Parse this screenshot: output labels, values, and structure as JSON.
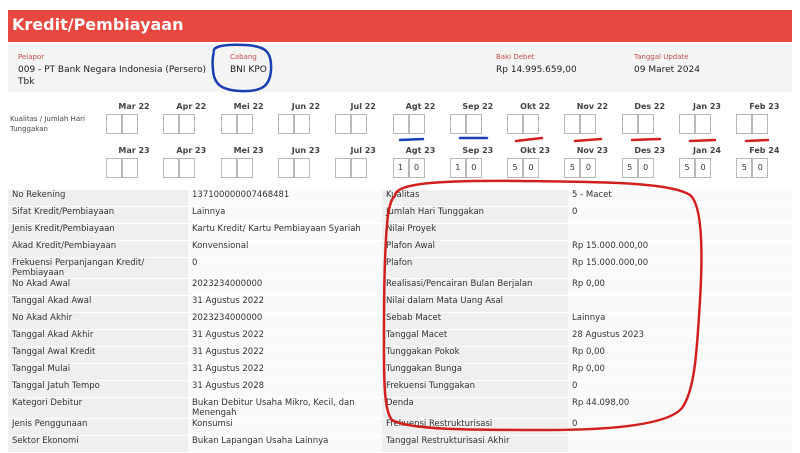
{
  "title": "Kredit/Pembiayaan",
  "info": {
    "pelapor_label": "Pelapor",
    "pelapor_value": "009 - PT Bank Negara Indonesia (Persero) Tbk",
    "cabang_label": "Cabang",
    "cabang_value": "BNI KPO",
    "baki_label": "Baki Debet",
    "baki_value": "Rp 14.995.659,00",
    "update_label": "Tanggal Update",
    "update_value": "09 Maret 2024"
  },
  "kualitas_label": "Kualitas / Jumlah Hari Tunggakan",
  "periods_row1": [
    "Mar 22",
    "Apr 22",
    "Mei 22",
    "Jun 22",
    "Jul 22",
    "Agt 22",
    "Sep 22",
    "Okt 22",
    "Nov 22",
    "Des 22",
    "Jan 23",
    "Feb 23"
  ],
  "periods_row2": [
    {
      "label": "Mar 23",
      "k": "",
      "d": ""
    },
    {
      "label": "Apr 23",
      "k": "",
      "d": ""
    },
    {
      "label": "Mei 23",
      "k": "",
      "d": ""
    },
    {
      "label": "Jun 23",
      "k": "",
      "d": ""
    },
    {
      "label": "Jul 23",
      "k": "",
      "d": ""
    },
    {
      "label": "Agt 23",
      "k": "1",
      "d": "0"
    },
    {
      "label": "Sep 23",
      "k": "1",
      "d": "0"
    },
    {
      "label": "Okt 23",
      "k": "5",
      "d": "0"
    },
    {
      "label": "Nov 23",
      "k": "5",
      "d": "0"
    },
    {
      "label": "Des 23",
      "k": "5",
      "d": "0"
    },
    {
      "label": "Jan 24",
      "k": "5",
      "d": "0"
    },
    {
      "label": "Feb 24",
      "k": "5",
      "d": "0"
    }
  ],
  "left_rows": [
    {
      "label": "No Rekening",
      "value": "137100000007468481"
    },
    {
      "label": "Sifat Kredit/Pembiayaan",
      "value": "Lainnya"
    },
    {
      "label": "Jenis Kredit/Pembiayaan",
      "value": "Kartu Kredit/ Kartu Pembiayaan Syariah"
    },
    {
      "label": "Akad Kredit/Pembiayaan",
      "value": "Konvensional"
    },
    {
      "label": "Frekuensi Perpanjangan Kredit/ Pembiayaan",
      "value": "0"
    },
    {
      "label": "No Akad Awal",
      "value": "2023234000000"
    },
    {
      "label": "Tanggal Akad Awal",
      "value": "31 Agustus 2022"
    },
    {
      "label": "No Akad Akhir",
      "value": "2023234000000"
    },
    {
      "label": "Tanggal Akad Akhir",
      "value": "31 Agustus 2022"
    },
    {
      "label": "Tanggal Awal Kredit",
      "value": "31 Agustus 2022"
    },
    {
      "label": "Tanggal Mulai",
      "value": "31 Agustus 2022"
    },
    {
      "label": "Tanggal Jatuh Tempo",
      "value": "31 Agustus 2028"
    },
    {
      "label": "Kategori Debitur",
      "value": "Bukan Debitur Usaha Mikro, Kecil, dan Menengah"
    },
    {
      "label": "Jenis Penggunaan",
      "value": "Konsumsi"
    },
    {
      "label": "Sektor Ekonomi",
      "value": "Bukan Lapangan Usaha Lainnya"
    }
  ],
  "right_rows": [
    {
      "label": "Kualitas",
      "value": "5 - Macet"
    },
    {
      "label": "Jumlah Hari Tunggakan",
      "value": "0"
    },
    {
      "label": "Nilai Proyek",
      "value": ""
    },
    {
      "label": "Plafon Awal",
      "value": "Rp 15.000.000,00"
    },
    {
      "label": "Plafon",
      "value": "Rp 15.000.000,00"
    },
    {
      "label": "Realisasi/Pencairan Bulan Berjalan",
      "value": "Rp 0,00"
    },
    {
      "label": "Nilai dalam Mata Uang Asal",
      "value": ""
    },
    {
      "label": "Sebab Macet",
      "value": "Lainnya"
    },
    {
      "label": "Tanggal Macet",
      "value": "28 Agustus 2023"
    },
    {
      "label": "Tunggakan Pokok",
      "value": "Rp 0,00"
    },
    {
      "label": "Tunggakan Bunga",
      "value": "Rp 0,00"
    },
    {
      "label": "Frekuensi Tunggakan",
      "value": "0"
    },
    {
      "label": "Denda",
      "value": "Rp 44.098,00"
    },
    {
      "label": "Frekuensi Restrukturisasi",
      "value": "0"
    },
    {
      "label": "Tanggal Restrukturisasi Akhir",
      "value": ""
    }
  ],
  "colors": {
    "accent": "#e8483f",
    "annotation_red": "#d21f1f",
    "annotation_blue": "#1a3fb0"
  }
}
